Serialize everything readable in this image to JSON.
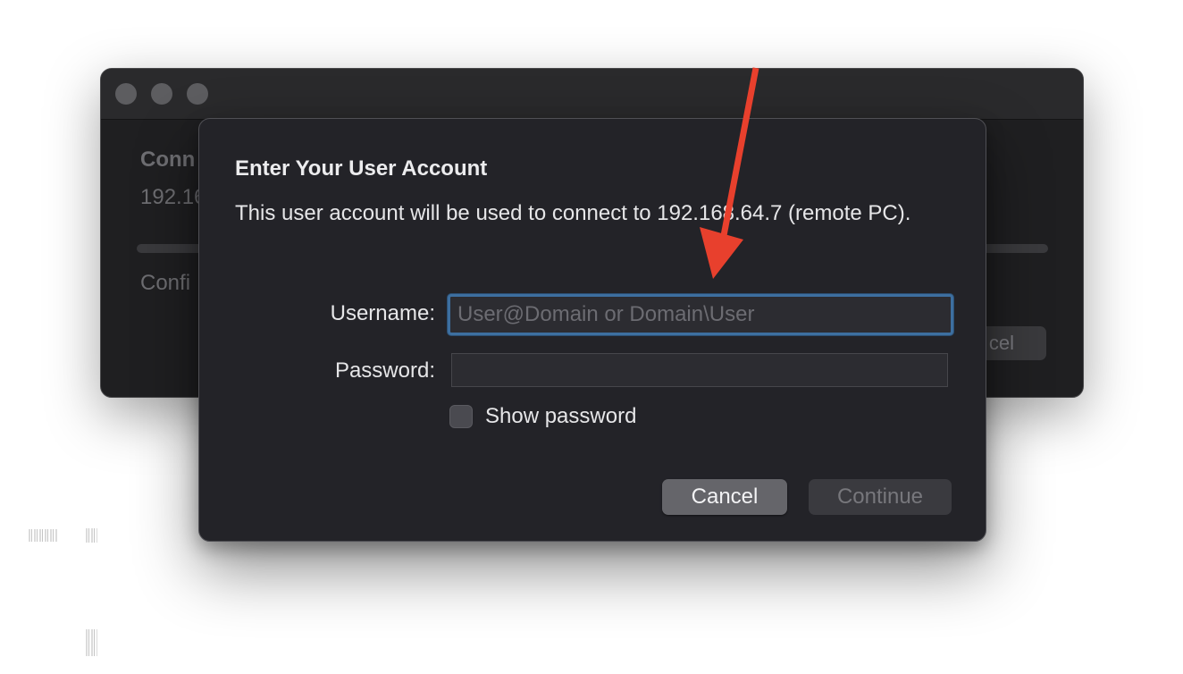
{
  "background_window": {
    "heading_visible": "Conn",
    "ip_visible": "192.16",
    "config_visible": "Confi",
    "cancel_visible": "cel",
    "traffic_lights": [
      "close",
      "minimize",
      "zoom"
    ]
  },
  "dialog": {
    "title": "Enter Your User Account",
    "message": "This user account will be used to connect to 192.168.64.7 (remote PC).",
    "username_label": "Username:",
    "username_placeholder": "User@Domain or Domain\\User",
    "username_value": "",
    "password_label": "Password:",
    "password_value": "",
    "show_password_label": "Show password",
    "show_password_checked": false,
    "cancel_label": "Cancel",
    "continue_label": "Continue",
    "continue_enabled": false
  },
  "annotation": {
    "arrow_color": "#e8402d",
    "points_to": "username-input"
  },
  "colors": {
    "dialog_bg": "#232328",
    "focus_ring": "#3d6fa0",
    "window_bg": "#1f1f21"
  }
}
